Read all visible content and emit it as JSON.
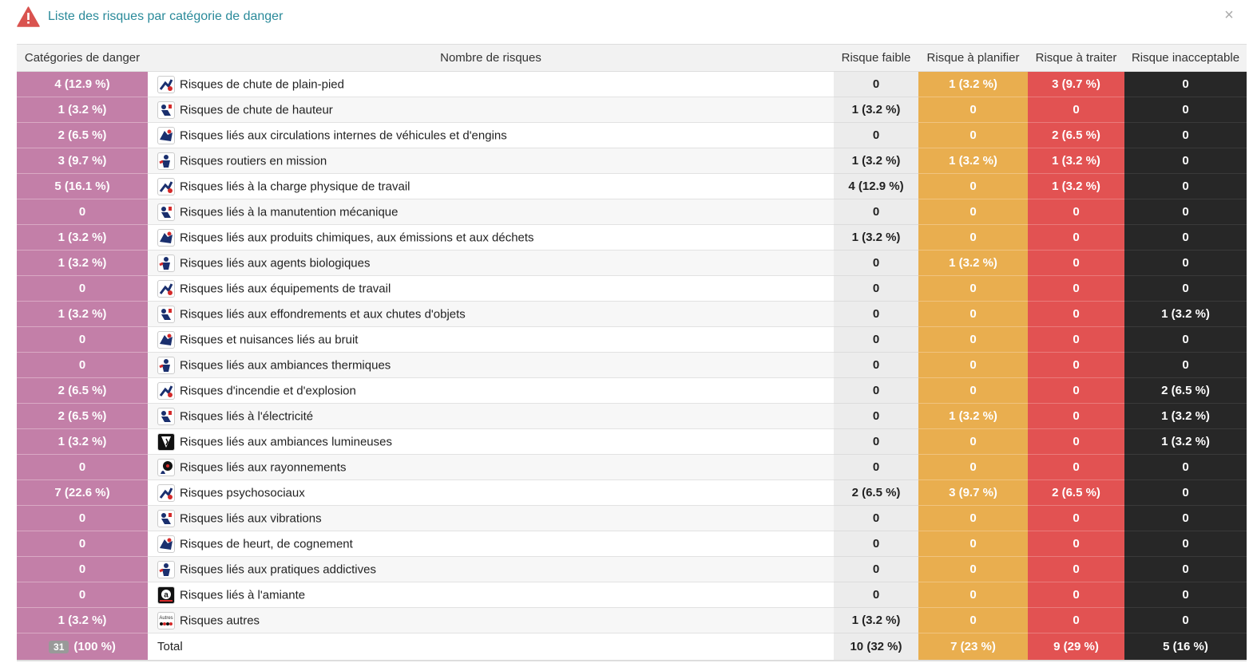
{
  "header": {
    "title": "Liste des risques par catégorie de danger",
    "close_label": "×"
  },
  "table": {
    "columns": {
      "categories": "Catégories de danger",
      "name": "Nombre de risques",
      "low": "Risque faible",
      "plan": "Risque à planifier",
      "treat": "Risque à traiter",
      "unacceptable": "Risque inacceptable"
    },
    "rows": [
      {
        "count": "4 (12.9 %)",
        "name": "Risques de chute de plain-pied",
        "icon": "slip-fall-icon",
        "low": "0",
        "plan": "1 (3.2 %)",
        "treat": "3 (9.7 %)",
        "unacceptable": "0"
      },
      {
        "count": "1 (3.2 %)",
        "name": "Risques de chute de hauteur",
        "icon": "fall-from-height-icon",
        "low": "1 (3.2 %)",
        "plan": "0",
        "treat": "0",
        "unacceptable": "0"
      },
      {
        "count": "2 (6.5 %)",
        "name": "Risques liés aux circulations internes de véhicules et d'engins",
        "icon": "forklift-icon",
        "low": "0",
        "plan": "0",
        "treat": "2 (6.5 %)",
        "unacceptable": "0"
      },
      {
        "count": "3 (9.7 %)",
        "name": "Risques routiers en mission",
        "icon": "road-vehicle-icon",
        "low": "1 (3.2 %)",
        "plan": "1 (3.2 %)",
        "treat": "1 (3.2 %)",
        "unacceptable": "0"
      },
      {
        "count": "5 (16.1 %)",
        "name": "Risques liés à la charge physique de travail",
        "icon": "physical-load-icon",
        "low": "4 (12.9 %)",
        "plan": "0",
        "treat": "1 (3.2 %)",
        "unacceptable": "0"
      },
      {
        "count": "0",
        "name": "Risques liés à la manutention mécanique",
        "icon": "mechanical-handling-icon",
        "low": "0",
        "plan": "0",
        "treat": "0",
        "unacceptable": "0"
      },
      {
        "count": "1 (3.2 %)",
        "name": "Risques liés aux produits chimiques, aux émissions et aux déchets",
        "icon": "chemical-icon",
        "low": "1 (3.2 %)",
        "plan": "0",
        "treat": "0",
        "unacceptable": "0"
      },
      {
        "count": "1 (3.2 %)",
        "name": "Risques liés aux agents biologiques",
        "icon": "biological-agent-icon",
        "low": "0",
        "plan": "1 (3.2 %)",
        "treat": "0",
        "unacceptable": "0"
      },
      {
        "count": "0",
        "name": "Risques liés aux équipements de travail",
        "icon": "work-equipment-icon",
        "low": "0",
        "plan": "0",
        "treat": "0",
        "unacceptable": "0"
      },
      {
        "count": "1 (3.2 %)",
        "name": "Risques liés aux effondrements et aux chutes d'objets",
        "icon": "falling-objects-icon",
        "low": "0",
        "plan": "0",
        "treat": "0",
        "unacceptable": "1 (3.2 %)"
      },
      {
        "count": "0",
        "name": "Risques et nuisances liés au bruit",
        "icon": "noise-icon",
        "low": "0",
        "plan": "0",
        "treat": "0",
        "unacceptable": "0"
      },
      {
        "count": "0",
        "name": "Risques liés aux ambiances thermiques",
        "icon": "thermal-icon",
        "low": "0",
        "plan": "0",
        "treat": "0",
        "unacceptable": "0"
      },
      {
        "count": "2 (6.5 %)",
        "name": "Risques d'incendie et d'explosion",
        "icon": "fire-explosion-icon",
        "low": "0",
        "plan": "0",
        "treat": "0",
        "unacceptable": "2 (6.5 %)"
      },
      {
        "count": "2 (6.5 %)",
        "name": "Risques liés à l'électricité",
        "icon": "electricity-icon",
        "low": "0",
        "plan": "1 (3.2 %)",
        "treat": "0",
        "unacceptable": "1 (3.2 %)"
      },
      {
        "count": "1 (3.2 %)",
        "name": "Risques liés aux ambiances lumineuses",
        "icon": "lighting-icon",
        "low": "0",
        "plan": "0",
        "treat": "0",
        "unacceptable": "1 (3.2 %)"
      },
      {
        "count": "0",
        "name": "Risques liés aux rayonnements",
        "icon": "radiation-icon",
        "low": "0",
        "plan": "0",
        "treat": "0",
        "unacceptable": "0"
      },
      {
        "count": "7 (22.6 %)",
        "name": "Risques psychosociaux",
        "icon": "psychosocial-icon",
        "low": "2 (6.5 %)",
        "plan": "3 (9.7 %)",
        "treat": "2 (6.5 %)",
        "unacceptable": "0"
      },
      {
        "count": "0",
        "name": "Risques liés aux vibrations",
        "icon": "vibration-icon",
        "low": "0",
        "plan": "0",
        "treat": "0",
        "unacceptable": "0"
      },
      {
        "count": "0",
        "name": "Risques de heurt, de cognement",
        "icon": "impact-icon",
        "low": "0",
        "plan": "0",
        "treat": "0",
        "unacceptable": "0"
      },
      {
        "count": "0",
        "name": "Risques liés aux pratiques addictives",
        "icon": "addiction-icon",
        "low": "0",
        "plan": "0",
        "treat": "0",
        "unacceptable": "0"
      },
      {
        "count": "0",
        "name": "Risques liés à l'amiante",
        "icon": "asbestos-icon",
        "low": "0",
        "plan": "0",
        "treat": "0",
        "unacceptable": "0"
      },
      {
        "count": "1 (3.2 %)",
        "name": "Risques autres",
        "icon": "other-risks-icon",
        "low": "1 (3.2 %)",
        "plan": "0",
        "treat": "0",
        "unacceptable": "0"
      }
    ],
    "total": {
      "badge": "31",
      "count": "(100 %)",
      "name": "Total",
      "low": "10 (32 %)",
      "plan": "7 (23 %)",
      "treat": "9 (29 %)",
      "unacceptable": "5 (16 %)"
    }
  },
  "icon_texts": {
    "asbestos": "a",
    "other": "Autres"
  },
  "colors": {
    "title": "#2a8a9a",
    "category": "#c37fa8",
    "low": "#ececec",
    "plan": "#e9ae4f",
    "treat": "#e25252",
    "unacceptable": "#272727",
    "warning": "#d9534f"
  }
}
